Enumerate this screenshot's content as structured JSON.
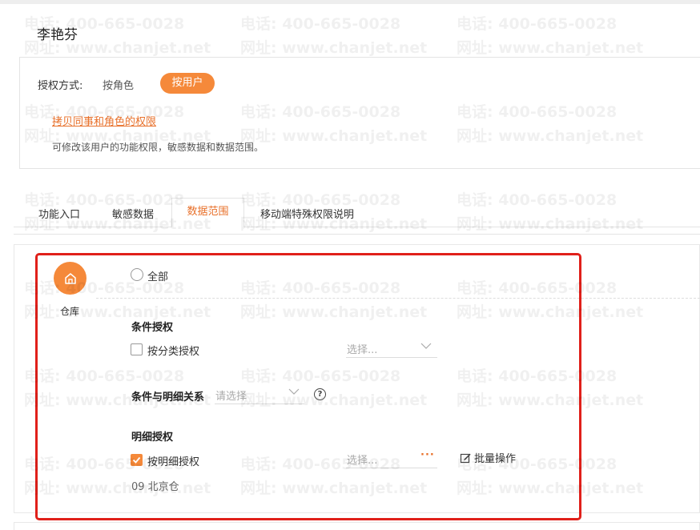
{
  "user": {
    "name": "李艳芬"
  },
  "auth": {
    "label": "授权方式:",
    "options": [
      {
        "label": "按角色",
        "selected": false
      },
      {
        "label": "按用户",
        "selected": true
      }
    ],
    "copy_link": "拷贝同事和角色的权限",
    "description": "可修改该用户的功能权限，敏感数据和数据范围。"
  },
  "tabs": [
    {
      "label": "功能入口",
      "active": false
    },
    {
      "label": "敏感数据",
      "active": false
    },
    {
      "label": "数据范围",
      "active": true
    },
    {
      "label": "移动端特殊权限说明",
      "active": false
    }
  ],
  "panel": {
    "category_label": "仓库",
    "all_option": {
      "label": "全部",
      "checked": false
    },
    "condition": {
      "title": "条件授权",
      "checkbox": {
        "label": "按分类授权",
        "checked": false
      },
      "select_placeholder": "选择..."
    },
    "relation": {
      "label": "条件与明细关系",
      "select_placeholder": "请选择",
      "help": "?"
    },
    "detail": {
      "title": "明细授权",
      "checkbox": {
        "label": "按明细授权",
        "checked": true
      },
      "select_placeholder": "选择...",
      "more": "···",
      "batch_label": "批量操作",
      "items": [
        "09 北京仓"
      ]
    }
  },
  "watermark": {
    "phone": "电话: 400-665-0028",
    "site": "网址: www.chanjet.net"
  },
  "colors": {
    "accent": "#f5893a",
    "link": "#e8702a",
    "highlight": "#e0201a"
  }
}
